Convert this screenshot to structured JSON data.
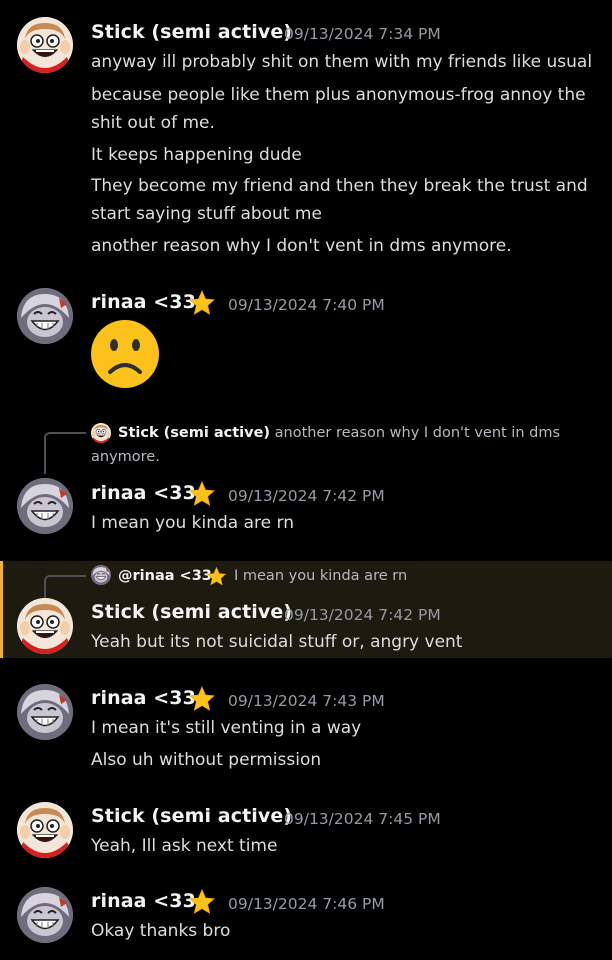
{
  "users": {
    "stick": {
      "name": "Stick (semi active)",
      "avatar_icon": "stick-avatar"
    },
    "rinaa": {
      "name": "rinaa <33",
      "badge_icon": "star-emoji",
      "avatar_icon": "rinaa-avatar"
    }
  },
  "messages": [
    {
      "author": "Stick (semi active)",
      "timestamp": "09/13/2024 7:34 PM",
      "lines": [
        "anyway ill probably shit on them with my friends like usual",
        "because people like them plus anonymous-frog annoy the shit out of me.",
        "It keeps happening dude",
        "They become my friend and then they break the trust and start saying stuff about me",
        "another reason why I don't vent in dms anymore."
      ]
    },
    {
      "author": "rinaa <33",
      "timestamp": "09/13/2024 7:40 PM",
      "emoji": "frowning-face-emoji"
    },
    {
      "reply_to": {
        "author": "Stick (semi active)",
        "text": "another reason why I don't vent in dms",
        "text_cont": "anymore."
      },
      "author": "rinaa <33",
      "timestamp": "09/13/2024 7:42 PM",
      "lines": [
        "I mean you kinda are rn"
      ]
    },
    {
      "reply_to": {
        "author": "@rinaa <33",
        "text": "I mean you kinda are rn"
      },
      "author": "Stick (semi active)",
      "timestamp": "09/13/2024 7:42 PM",
      "lines": [
        "Yeah but its not suicidal stuff or, angry vent"
      ],
      "highlighted": true
    },
    {
      "author": "rinaa <33",
      "timestamp": "09/13/2024 7:43 PM",
      "lines": [
        "I mean it's still venting in a way",
        "Also uh without permission"
      ]
    },
    {
      "author": "Stick (semi active)",
      "timestamp": "09/13/2024 7:45 PM",
      "lines": [
        "Yeah, Ill ask next time"
      ]
    },
    {
      "author": "rinaa <33",
      "timestamp": "09/13/2024 7:46 PM",
      "lines": [
        "Okay thanks bro"
      ]
    }
  ],
  "colors": {
    "background": "#000000",
    "username": "#f2f3f5",
    "timestamp": "#949ba4",
    "text": "#dbdee1",
    "mention_highlight_bg": "#1d1a10",
    "mention_highlight_bar": "#f0b232"
  }
}
